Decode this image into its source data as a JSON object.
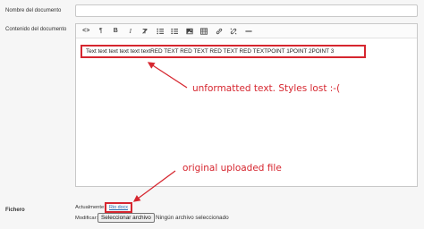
{
  "form": {
    "nombre_label": "Nombre del documento",
    "nombre_value": "",
    "contenido_label": "Contenido del documento",
    "fichero_label": "Fichero"
  },
  "toolbar": {
    "buttons": [
      {
        "name": "source-code-icon",
        "glyph": "<>"
      },
      {
        "name": "paragraph-icon",
        "glyph": "¶"
      },
      {
        "name": "bold-icon",
        "glyph": "B"
      },
      {
        "name": "italic-icon",
        "glyph": "I"
      },
      {
        "name": "clear-format-icon",
        "glyph": "Ⱡ"
      },
      {
        "name": "bullet-list-icon",
        "glyph": "≔"
      },
      {
        "name": "numbered-list-icon",
        "glyph": "≔"
      },
      {
        "name": "image-icon",
        "glyph": "▣"
      },
      {
        "name": "table-icon",
        "glyph": "▦"
      },
      {
        "name": "link-icon",
        "glyph": "∞"
      },
      {
        "name": "unlink-icon",
        "glyph": "⊘"
      },
      {
        "name": "horizontal-rule-icon",
        "glyph": "—"
      }
    ]
  },
  "editor": {
    "content_text": "Text text text text text textRED TEXT RED TEXT RED TEXT RED TEXTPOINT 1POINT 2POINT 3"
  },
  "annotations": {
    "unformatted": "unformatted text. Styles lost :-(",
    "original": "original uploaded file"
  },
  "file": {
    "actual_label": "Actualmente:",
    "actual_link": "Rio docx",
    "modificar_label": "Modificar:",
    "button_label": "Seleccionar archivo",
    "no_file_text": "Ningún archivo seleccionado"
  },
  "colors": {
    "annotation_red": "#d6262f",
    "link_blue": "#2a6fb5",
    "page_bg": "#f6f6f6"
  }
}
